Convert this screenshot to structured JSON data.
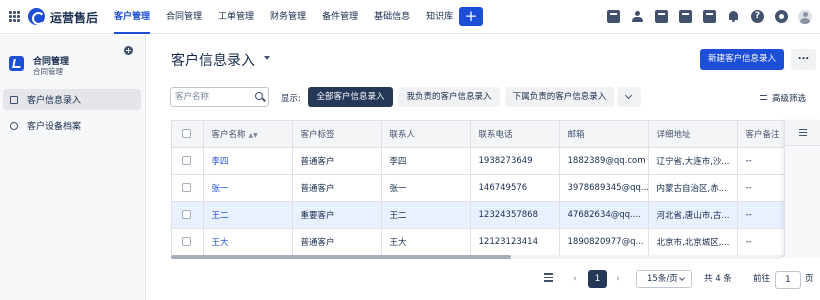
{
  "app": {
    "name": "运营售后"
  },
  "nav": [
    "客户管理",
    "合同管理",
    "工单管理",
    "财务管理",
    "备件管理",
    "基础信息",
    "知识库"
  ],
  "nav_active_index": 0,
  "create_button": "+",
  "top_icons": [
    "checkbox-icon",
    "person-icon",
    "document-icon",
    "phone-icon",
    "calendar-icon",
    "bell-icon",
    "help-icon",
    "gear-icon",
    "avatar"
  ],
  "sidebar": {
    "project_title": "合同管理",
    "project_subtitle": "合同管理",
    "items": [
      {
        "label": "客户信息录入",
        "active": true
      },
      {
        "label": "客户设备档案",
        "active": false
      }
    ]
  },
  "page": {
    "title": "客户信息录入",
    "new_button": "新建客户信息录入",
    "more_button": "..."
  },
  "filters": {
    "search_placeholder": "客户名称",
    "show_label": "显示:",
    "options": [
      "全部客户信息录入",
      "我负责的客户信息录入",
      "下属负责的客户信息录入"
    ],
    "active_index": 0,
    "advanced": "高级筛选"
  },
  "table": {
    "columns": [
      "客户名称",
      "客户标签",
      "联系人",
      "联系电话",
      "邮箱",
      "详细地址",
      "客户备注"
    ],
    "rows": [
      [
        "李四",
        "普通客户",
        "李四",
        "1938273649",
        "1882389@qq.com",
        "辽宁省,大连市,沙...",
        "--"
      ],
      [
        "张一",
        "普通客户",
        "张一",
        "146749576",
        "3978689345@qq...",
        "内蒙古自治区,赤...",
        "--"
      ],
      [
        "王二",
        "重要客户",
        "王二",
        "12324357868",
        "47682634@qq....",
        "河北省,唐山市,古...",
        "--"
      ],
      [
        "王大",
        "普通客户",
        "王大",
        "12123123414",
        "1890820977@q...",
        "北京市,北京城区,...",
        "--"
      ]
    ],
    "selected_row": 2
  },
  "pagination": {
    "current_page": "1",
    "page_size": "15条/页",
    "total": "共 4 条",
    "goto_label": "前往",
    "goto_value": "1",
    "page_suffix": "页"
  },
  "colors": {
    "accent": "#1d4ed8",
    "dark": "#253858",
    "selected_row": "#e9f0ff"
  }
}
